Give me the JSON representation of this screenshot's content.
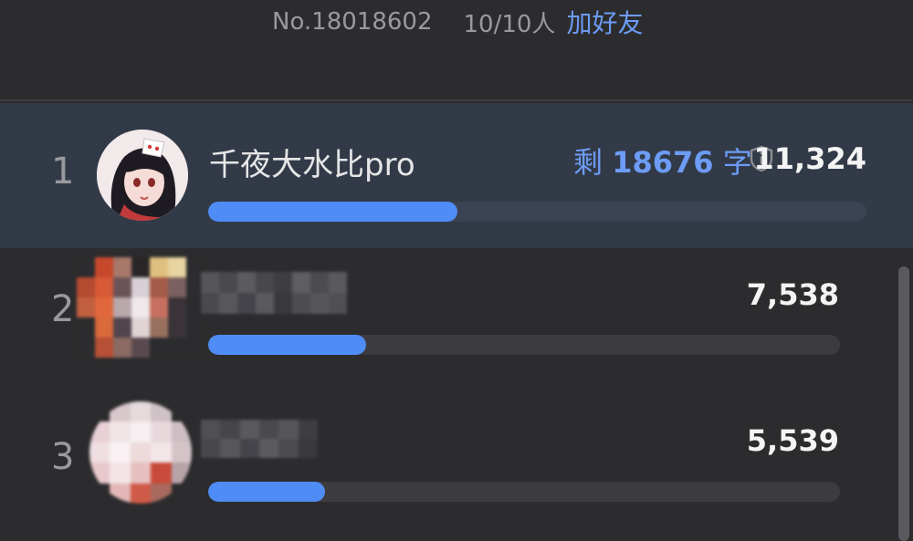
{
  "header": {
    "room_no": "No.18018602",
    "member_count": "10/10人",
    "add_friend_label": "加好友"
  },
  "leaderboard": [
    {
      "rank": "1",
      "name": "千夜大水比pro",
      "remaining_prefix": "剩",
      "remaining_value": "18676",
      "remaining_suffix": "字",
      "score": "11,324",
      "progress": 0.378,
      "avatar": "anime-girl-avatar"
    },
    {
      "rank": "2",
      "name": "",
      "score": "7,538",
      "progress": 0.25,
      "avatar": "blurred-avatar"
    },
    {
      "rank": "3",
      "name": "",
      "score": "5,539",
      "progress": 0.185,
      "avatar": "blurred-avatar"
    }
  ],
  "colors": {
    "accent": "#4f8cf5",
    "highlight_row": "#323a48",
    "background": "#2c2c2e"
  }
}
